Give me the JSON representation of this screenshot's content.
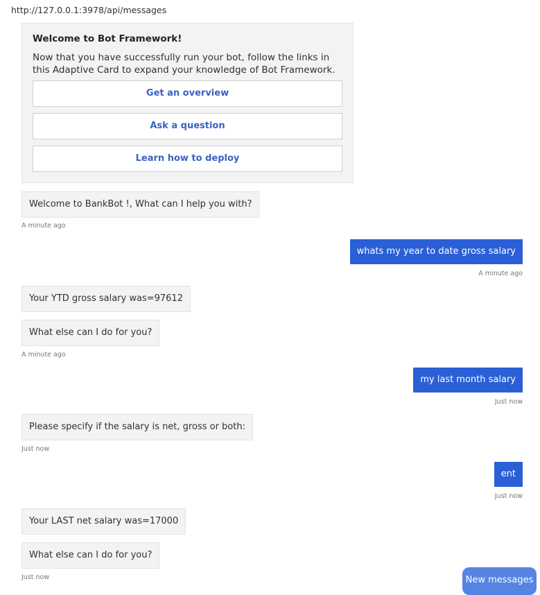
{
  "endpoint_url": "http://127.0.0.1:3978/api/messages",
  "card": {
    "title": "Welcome to Bot Framework!",
    "body": "Now that you have successfully run your bot, follow the links in this Adaptive Card to expand your knowledge of Bot Framework.",
    "buttons": [
      "Get an overview",
      "Ask a question",
      "Learn how to deploy"
    ]
  },
  "messages": [
    {
      "from": "bot",
      "text": "Welcome to BankBot !, What can I help you with?"
    },
    {
      "from": "user",
      "text": "whats my year to date gross salary"
    },
    {
      "from": "bot",
      "text": "Your YTD gross salary was=97612"
    },
    {
      "from": "bot",
      "text": "What else can I do for you?"
    },
    {
      "from": "user",
      "text": "my last month salary"
    },
    {
      "from": "bot",
      "text": "Please specify if the salary is net, gross or both:"
    },
    {
      "from": "user",
      "text": "ent"
    },
    {
      "from": "bot",
      "text": "Your LAST net salary was=17000"
    },
    {
      "from": "bot",
      "text": "What else can I do for you?"
    }
  ],
  "timestamps": [
    "A minute ago",
    "A minute ago",
    "A minute ago",
    "Just now",
    "Just now",
    "Just now",
    "Just now"
  ],
  "new_messages_label": "New messages",
  "colors": {
    "user_bubble": "#2b5fd6",
    "link_text": "#3a62c3",
    "new_messages_button": "#5584e3"
  }
}
